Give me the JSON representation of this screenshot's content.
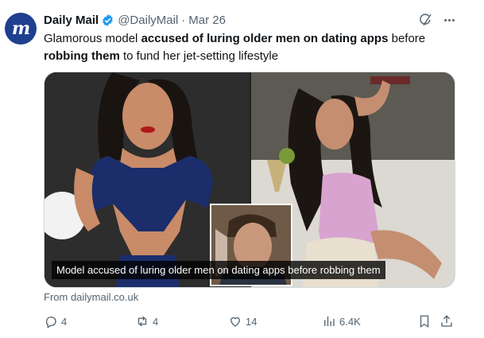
{
  "account": {
    "name": "Daily Mail",
    "handle": "@DailyMail",
    "separator": "·",
    "date": "Mar 26",
    "avatar_letter": "m",
    "avatar_color": "#1f3f8f",
    "verified_color": "#1d9bf0"
  },
  "tweet": {
    "text_part1": "Glamorous model ",
    "text_bold1": "accused of luring older men on dating apps",
    "text_part2": " before ",
    "text_bold2": "robbing them",
    "text_part3": " to fund her jet-setting lifestyle"
  },
  "media": {
    "caption": "Model accused of luring older men on dating apps before robbing them"
  },
  "card": {
    "source": "From dailymail.co.uk"
  },
  "actions": {
    "replies": "4",
    "reposts": "4",
    "likes": "14",
    "views": "6.4K"
  },
  "icons": [
    "verified-badge-icon",
    "grok-icon",
    "more-icon",
    "reply-icon",
    "repost-icon",
    "like-icon",
    "views-icon",
    "bookmark-icon",
    "share-icon"
  ]
}
